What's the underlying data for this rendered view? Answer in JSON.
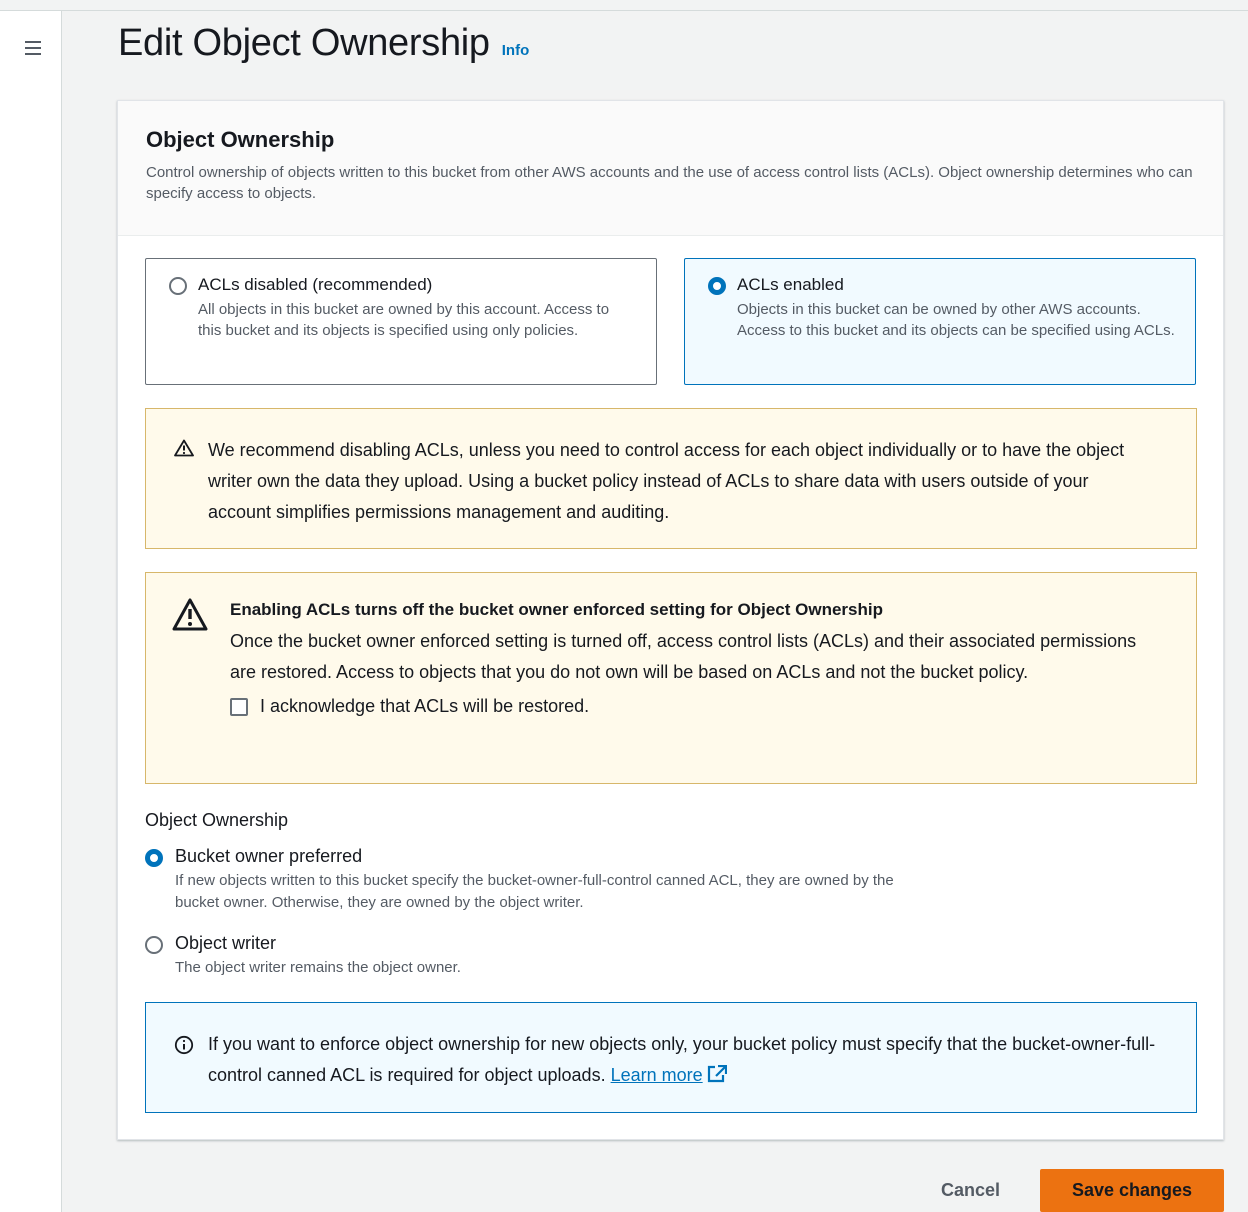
{
  "header": {
    "title": "Edit Object Ownership",
    "info_link": "Info"
  },
  "section": {
    "title": "Object Ownership",
    "description": "Control ownership of objects written to this bucket from other AWS accounts and the use of access control lists (ACLs). Object ownership determines who can specify access to objects."
  },
  "acl_tiles": [
    {
      "label": "ACLs disabled (recommended)",
      "description": "All objects in this bucket are owned by this account. Access to this bucket and its objects is specified using only policies.",
      "selected": false
    },
    {
      "label": "ACLs enabled",
      "description": "Objects in this bucket can be owned by other AWS accounts. Access to this bucket and its objects can be specified using ACLs.",
      "selected": true
    }
  ],
  "recommend_alert": {
    "text": "We recommend disabling ACLs, unless you need to control access for each object individually or to have the object writer own the data they upload. Using a bucket policy instead of ACLs to share data with users outside of your account simplifies permissions management and auditing."
  },
  "enable_alert": {
    "title": "Enabling ACLs turns off the bucket owner enforced setting for Object Ownership",
    "text": "Once the bucket owner enforced setting is turned off, access control lists (ACLs) and their associated permissions are restored. Access to objects that you do not own will be based on ACLs and not the bucket policy.",
    "acknowledge_label": "I acknowledge that ACLs will be restored.",
    "acknowledged": false
  },
  "ownership": {
    "label": "Object Ownership",
    "options": [
      {
        "label": "Bucket owner preferred",
        "description": "If new objects written to this bucket specify the bucket-owner-full-control canned ACL, they are owned by the bucket owner. Otherwise, they are owned by the object writer.",
        "selected": true
      },
      {
        "label": "Object writer",
        "description": "The object writer remains the object owner.",
        "selected": false
      }
    ]
  },
  "info_alert": {
    "text": "If you want to enforce object ownership for new objects only, your bucket policy must specify that the bucket-owner-full-control canned ACL is required for object uploads.",
    "link_label": "Learn more"
  },
  "actions": {
    "cancel_label": "Cancel",
    "save_label": "Save changes"
  },
  "colors": {
    "accent": "#0073bb",
    "primary_button": "#ec7211",
    "warning_bg": "#fffaeb",
    "warning_border": "#d7b76a",
    "info_bg": "#f1faff"
  },
  "icons": [
    "menu-icon",
    "warning-icon",
    "info-circle-icon",
    "external-link-icon"
  ]
}
